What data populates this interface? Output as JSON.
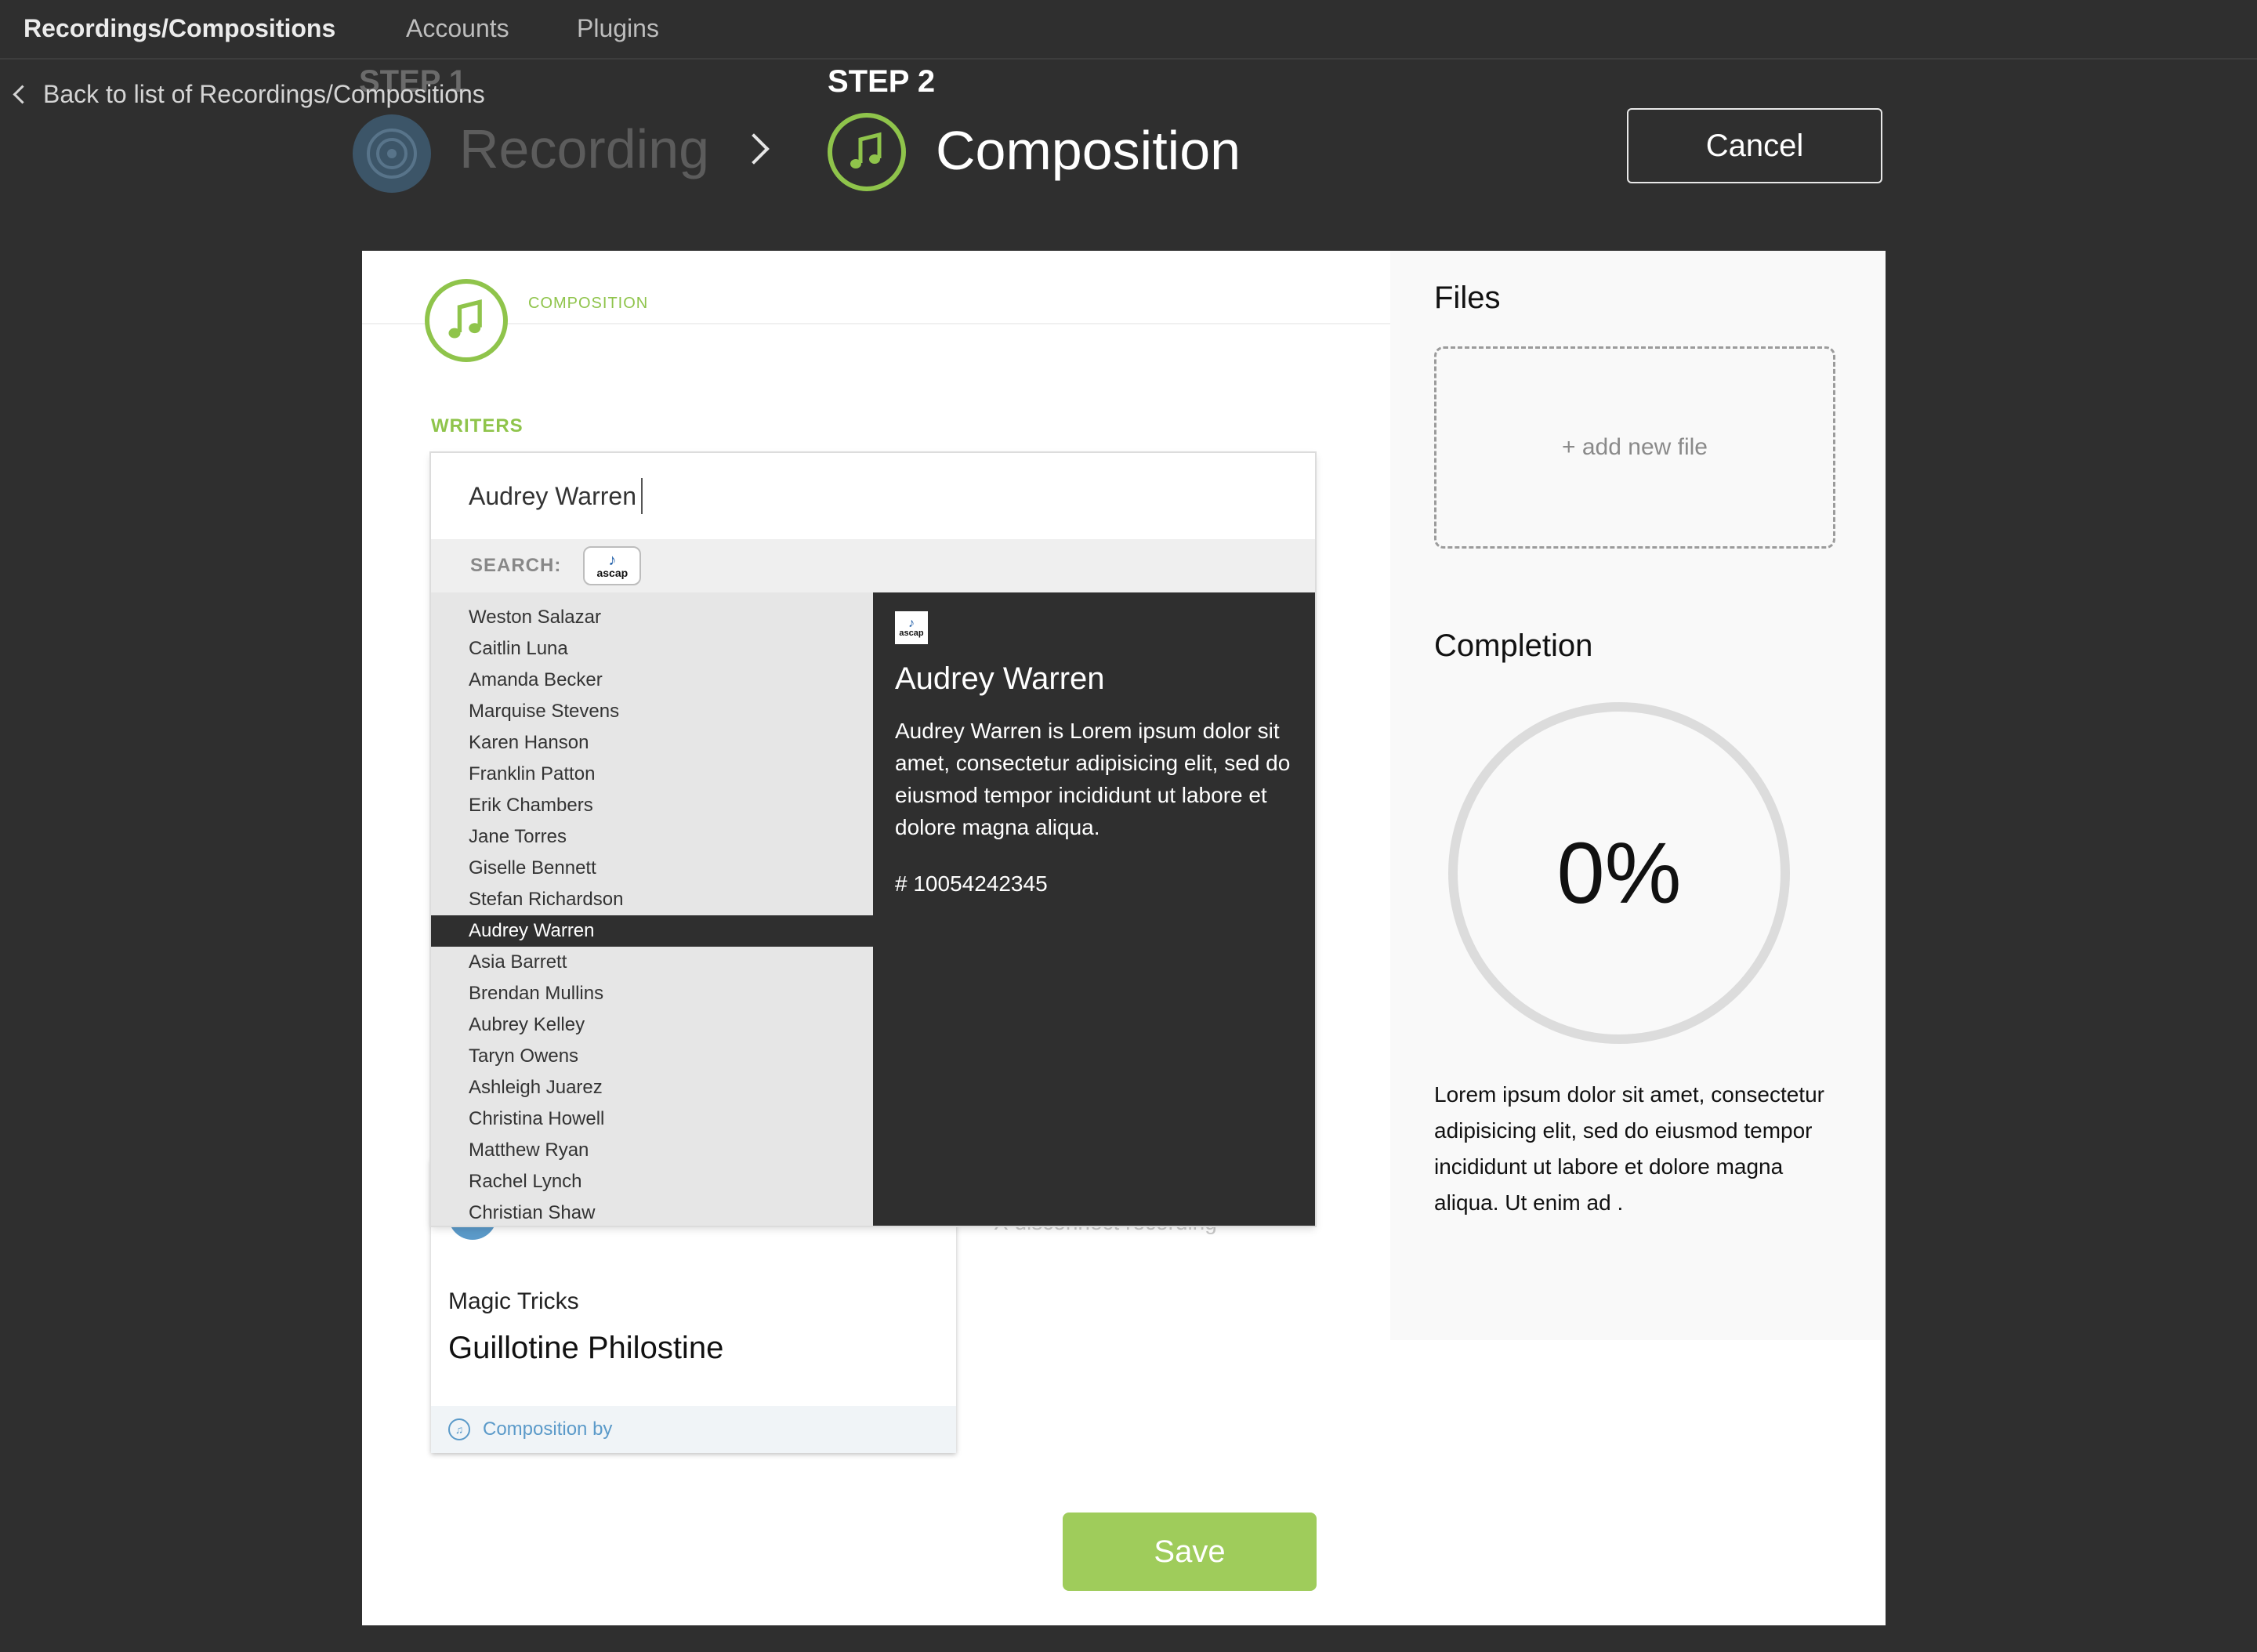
{
  "nav": {
    "brand": "Recordings/Compositions",
    "items": [
      "Accounts",
      "Plugins"
    ],
    "back_link": "Back to list of Recordings/Compositions"
  },
  "steps": {
    "step1": {
      "label": "STEP 1",
      "title": "Recording",
      "icon": "vinyl-disc-icon"
    },
    "step2": {
      "label": "STEP 2",
      "title": "Composition",
      "icon": "music-note-icon"
    },
    "cancel_label": "Cancel"
  },
  "form": {
    "section_label": "COMPOSITION",
    "writers_label": "WRITERS",
    "writer_input_value": "Audrey Warren",
    "search_label": "SEARCH:",
    "search_source": "ascap"
  },
  "results": [
    "Weston Salazar",
    "Caitlin Luna",
    "Amanda Becker",
    "Marquise Stevens",
    "Karen Hanson",
    "Franklin Patton",
    "Erik Chambers",
    "Jane Torres",
    "Giselle Bennett",
    "Stefan Richardson",
    "Audrey Warren",
    "Asia Barrett",
    "Brendan Mullins",
    "Aubrey Kelley",
    "Taryn Owens",
    "Ashleigh Juarez",
    "Christina Howell",
    "Matthew Ryan",
    "Rachel Lynch",
    "Christian Shaw"
  ],
  "selected_index": 10,
  "detail": {
    "source_badge": "ascap",
    "name": "Audrey Warren",
    "bio": "Audrey Warren is Lorem ipsum dolor sit amet, consectetur adipisicing elit, sed do eiusmod tempor incididunt ut labore et dolore magna aliqua.",
    "number": "# 10054242345"
  },
  "recording_card": {
    "subtitle": "Magic Tricks",
    "title": "Guillotine Philostine",
    "footer": "Composition by",
    "disconnect": "X disconnect recording"
  },
  "side": {
    "files_title": "Files",
    "add_file": "+ add new file",
    "completion_title": "Completion",
    "completion_value": "0%",
    "completion_text": "Lorem ipsum dolor sit amet, consectetur adipisicing elit, sed do eiusmod tempor incididunt ut labore et dolore magna aliqua. Ut enim ad ."
  },
  "save_label": "Save",
  "colors": {
    "accent_green": "#8fc44b",
    "save_green": "#9fcc5b",
    "dark_bg": "#2f2f2f",
    "link_blue": "#5b9ac9"
  }
}
